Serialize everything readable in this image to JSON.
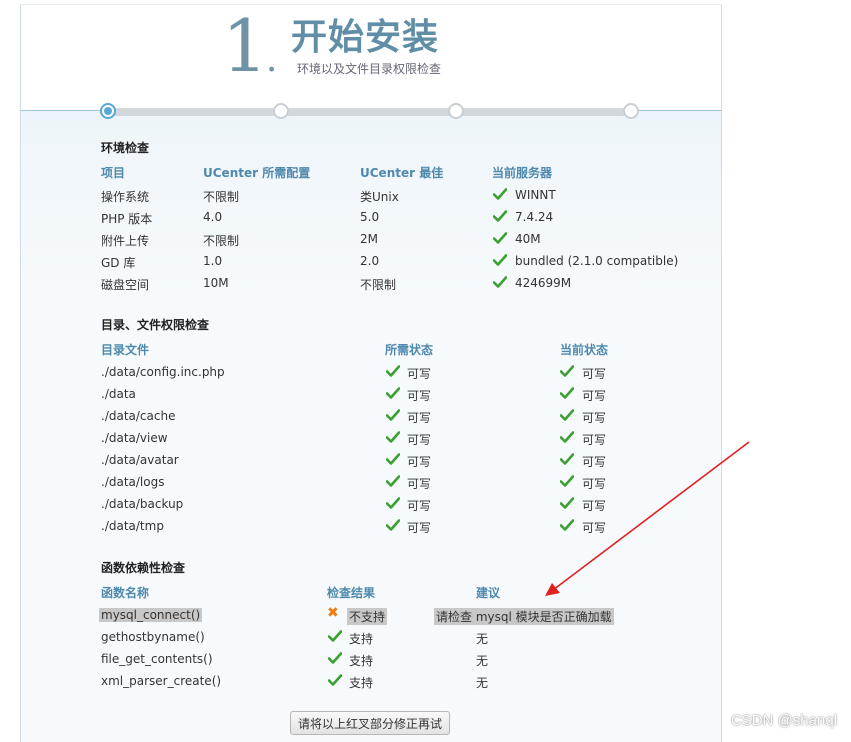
{
  "header": {
    "step_number": "1",
    "step_dot": ".",
    "title": "开始安装",
    "subtitle": "环境以及文件目录权限检查"
  },
  "env": {
    "section_title": "环境检查",
    "headers": [
      "项目",
      "UCenter 所需配置",
      "UCenter 最佳",
      "当前服务器"
    ],
    "rows": [
      {
        "item": "操作系统",
        "required": "不限制",
        "best": "类Unix",
        "current": "WINNT"
      },
      {
        "item": "PHP 版本",
        "required": "4.0",
        "best": "5.0",
        "current": "7.4.24"
      },
      {
        "item": "附件上传",
        "required": "不限制",
        "best": "2M",
        "current": "40M"
      },
      {
        "item": "GD 库",
        "required": "1.0",
        "best": "2.0",
        "current": "bundled (2.1.0 compatible)"
      },
      {
        "item": "磁盘空间",
        "required": "10M",
        "best": "不限制",
        "current": "424699M"
      }
    ]
  },
  "dirs": {
    "section_title": "目录、文件权限检查",
    "headers": [
      "目录文件",
      "所需状态",
      "当前状态"
    ],
    "status_label": "可写",
    "rows": [
      "./data/config.inc.php",
      "./data",
      "./data/cache",
      "./data/view",
      "./data/avatar",
      "./data/logs",
      "./data/backup",
      "./data/tmp"
    ]
  },
  "funcs": {
    "section_title": "函数依赖性检查",
    "headers": [
      "函数名称",
      "检查结果",
      "建议"
    ],
    "rows": [
      {
        "name": "mysql_connect()",
        "result": "不支持",
        "advice": "请检查 mysql 模块是否正确加载",
        "ok": false
      },
      {
        "name": "gethostbyname()",
        "result": "支持",
        "advice": "无",
        "ok": true
      },
      {
        "name": "file_get_contents()",
        "result": "支持",
        "advice": "无",
        "ok": true
      },
      {
        "name": "xml_parser_create()",
        "result": "支持",
        "advice": "无",
        "ok": true
      }
    ]
  },
  "footer": {
    "button_label": "请将以上红叉部分修正再试"
  },
  "watermark": "CSDN @shanql",
  "colors": {
    "accent": "#4f89ae",
    "check": "#3aa030",
    "fail": "#ef7d14",
    "arrow": "#e02020"
  }
}
